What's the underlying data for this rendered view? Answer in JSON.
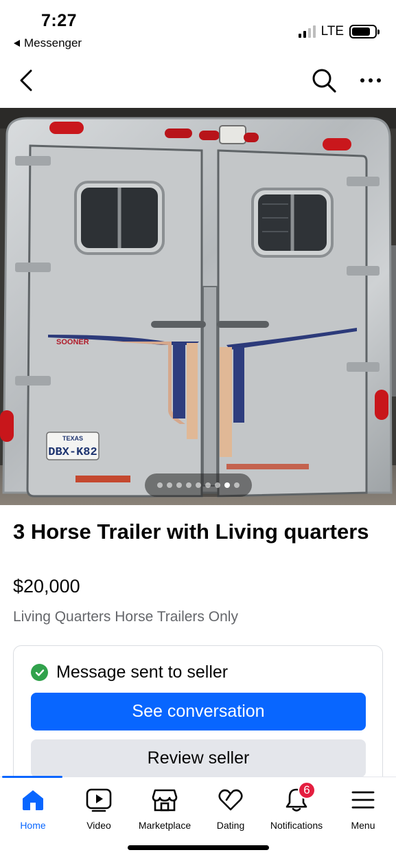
{
  "status_bar": {
    "time": "7:27",
    "back_app": "Messenger",
    "network": "LTE"
  },
  "nav": {
    "back_icon": "chevron-left-icon",
    "search_icon": "search-icon",
    "more_icon": "more-horizontal-icon"
  },
  "photo": {
    "plate_state": "TEXAS",
    "plate_number": "DBX-K82",
    "brand": "SOONER",
    "carousel_count": 9,
    "carousel_active_index": 7
  },
  "listing": {
    "title": "3 Horse Trailer with Living quarters",
    "price": "$20,000",
    "category": "Living Quarters Horse Trailers Only"
  },
  "message_card": {
    "status_text": "Message sent to seller",
    "primary_button": "See conversation",
    "secondary_button": "Review seller"
  },
  "tabs": [
    {
      "label": "Home",
      "icon": "home-icon",
      "active": true
    },
    {
      "label": "Video",
      "icon": "video-icon"
    },
    {
      "label": "Marketplace",
      "icon": "marketplace-icon"
    },
    {
      "label": "Dating",
      "icon": "dating-heart-icon"
    },
    {
      "label": "Notifications",
      "icon": "bell-icon",
      "badge": "6"
    },
    {
      "label": "Menu",
      "icon": "menu-icon"
    }
  ],
  "colors": {
    "accent": "#0866ff",
    "success": "#31a24c",
    "badge": "#e41e3f",
    "secondary_button": "#e4e6eb",
    "muted_text": "#65676b"
  }
}
